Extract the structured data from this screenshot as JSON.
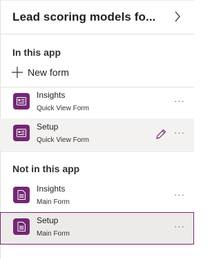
{
  "header": {
    "title": "Lead scoring models fo..."
  },
  "in_app": {
    "heading": "In this app",
    "new_form_label": "New form",
    "items": [
      {
        "title": "Insights",
        "subtitle": "Quick View Form"
      },
      {
        "title": "Setup",
        "subtitle": "Quick View Form"
      }
    ]
  },
  "not_in_app": {
    "heading": "Not in this app",
    "items": [
      {
        "title": "Insights",
        "subtitle": "Main Form"
      },
      {
        "title": "Setup",
        "subtitle": "Main Form"
      }
    ]
  },
  "more_label": "···",
  "colors": {
    "accent": "#742774",
    "selected_bg": "#edebe9",
    "hover_bg": "#f3f2f1",
    "divider": "#e1dfdd"
  },
  "icons": {
    "quick_view": "quick-view-form-icon",
    "main_form": "main-form-icon",
    "edit": "pencil-icon",
    "more": "more-options-icon",
    "chevron": "chevron-right-icon",
    "add": "plus-icon"
  }
}
